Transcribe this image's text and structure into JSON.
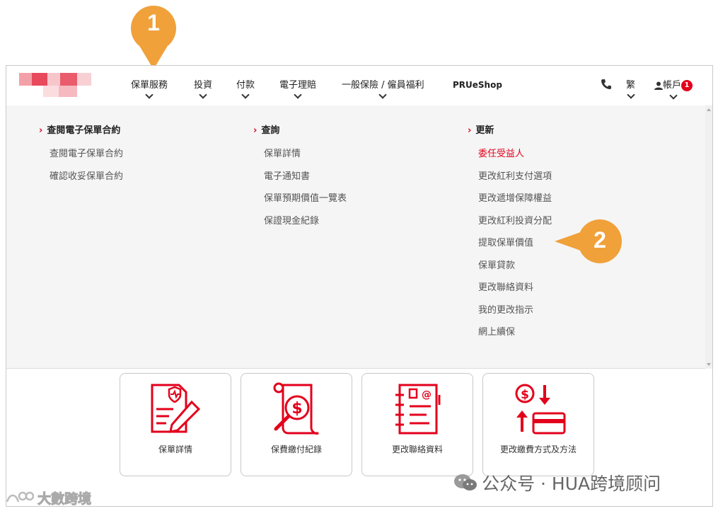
{
  "nav": {
    "items": [
      "保單服務",
      "投資",
      "付款",
      "電子理賠",
      "一般保險 / 僱員福利"
    ],
    "shop": "PRUeShop",
    "lang": "繁",
    "account": "帳戶",
    "account_badge": "1"
  },
  "menu": {
    "col1": {
      "heading": "查閱電子保單合約",
      "links": [
        "查閱電子保單合約",
        "確認收妥保單合約"
      ]
    },
    "col2": {
      "heading": "查詢",
      "links": [
        "保單詳情",
        "電子通知書",
        "保單預期價值一覽表",
        "保證現金紀錄"
      ]
    },
    "col3": {
      "heading": "更新",
      "links": [
        "委任受益人",
        "更改紅利支付選項",
        "更改遞增保障權益",
        "更改紅利投資分配",
        "提取保單價值",
        "保單貸款",
        "更改聯絡資料",
        "我的更改指示",
        "網上續保"
      ]
    }
  },
  "tiles": [
    "保單詳情",
    "保費繳付紀錄",
    "更改聯絡資料",
    "更改繳費方式及方法"
  ],
  "callouts": {
    "one": "1",
    "two": "2"
  },
  "watermark": {
    "wechat": "公众号 · HUA跨境顾问",
    "corner": "大數跨境"
  },
  "colors": {
    "brand": "#e3001b",
    "callout": "#f0a13a",
    "menu_bg": "#f5f5f5"
  }
}
